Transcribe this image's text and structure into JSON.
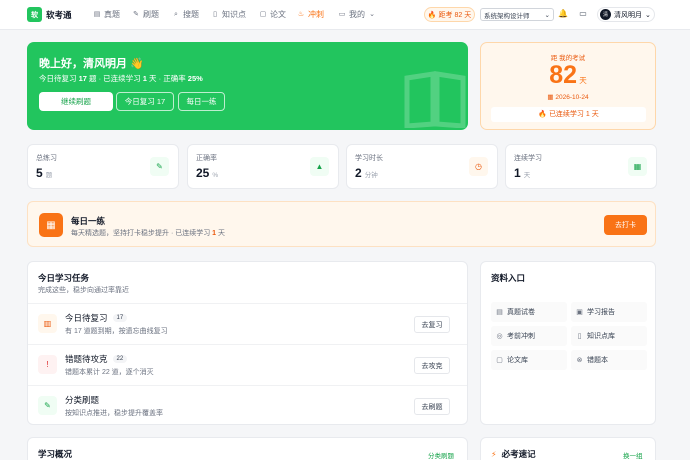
{
  "brand": {
    "logo_char": "软",
    "name": "软考通"
  },
  "nav": {
    "items": [
      {
        "label": "真题",
        "icon": "document-icon"
      },
      {
        "label": "刷题",
        "icon": "pen-icon"
      },
      {
        "label": "搜题",
        "icon": "search-icon"
      },
      {
        "label": "知识点",
        "icon": "book-icon"
      },
      {
        "label": "论文",
        "icon": "file-icon"
      },
      {
        "label": "冲刺",
        "icon": "flame-icon"
      },
      {
        "label": "我的",
        "icon": "briefcase-icon"
      }
    ],
    "active_item": "冲刺",
    "countdown_pill": "距考 82 天",
    "exam_select": "系统架构设计师",
    "user": {
      "avatar_char": "清",
      "name": "清风明月"
    }
  },
  "hero": {
    "greeting": "晚上好，清风明月 👋",
    "sub_prefix": "今日待复习 ",
    "review_count": "17",
    "sub_mid1": " 题 · 已连续学习 ",
    "streak": "1",
    "sub_mid2": " 天 · 正确率 ",
    "accuracy": "25%",
    "buttons": {
      "continue": "继续刷题",
      "review": "今日复习 17",
      "daily": "每日一练"
    }
  },
  "countdown": {
    "label": "距 我的考试",
    "days": "82",
    "unit": "天",
    "date": "2026-10-24",
    "streak_text": "已连续学习 1 天"
  },
  "stats": [
    {
      "label": "总练习",
      "value": "5",
      "unit": "题",
      "icon": "pencil-icon"
    },
    {
      "label": "正确率",
      "value": "25",
      "unit": "%",
      "icon": "chart-icon"
    },
    {
      "label": "学习时长",
      "value": "2",
      "unit": "分钟",
      "icon": "clock-icon"
    },
    {
      "label": "连续学习",
      "value": "1",
      "unit": "天",
      "icon": "calendar-icon"
    }
  ],
  "daily": {
    "title": "每日一练",
    "sub_prefix": "每天精选题，坚持打卡稳步提升 · 已连续学习 ",
    "streak": "1",
    "sub_suffix": " 天",
    "button": "去打卡"
  },
  "tasks": {
    "title": "今日学习任务",
    "subtitle": "完成这些，稳步向通过率靠近",
    "items": [
      {
        "name": "今日待复习",
        "badge": "17",
        "desc": "有 17 道题到期，按遗忘曲线复习",
        "button": "去复习"
      },
      {
        "name": "错题待攻克",
        "badge": "22",
        "desc": "错题本累计 22 道，逐个消灭",
        "button": "去攻克"
      },
      {
        "name": "分类刷题",
        "badge": "",
        "desc": "按知识点推进，稳步提升覆盖率",
        "button": "去刷题"
      }
    ]
  },
  "resources": {
    "title": "资料入口",
    "items": [
      {
        "label": "真题试卷",
        "icon": "document-icon"
      },
      {
        "label": "学习报告",
        "icon": "report-icon"
      },
      {
        "label": "考前冲刺",
        "icon": "target-icon"
      },
      {
        "label": "知识点库",
        "icon": "book-icon"
      },
      {
        "label": "论文库",
        "icon": "file-icon"
      },
      {
        "label": "错题本",
        "icon": "x-circle-icon"
      }
    ]
  },
  "bottom": {
    "left_title": "学习概况",
    "left_link": "分类刷题",
    "right_title": "必考速记",
    "right_link": "换一组"
  },
  "colors": {
    "green": "#22c55e",
    "orange": "#f97316"
  }
}
